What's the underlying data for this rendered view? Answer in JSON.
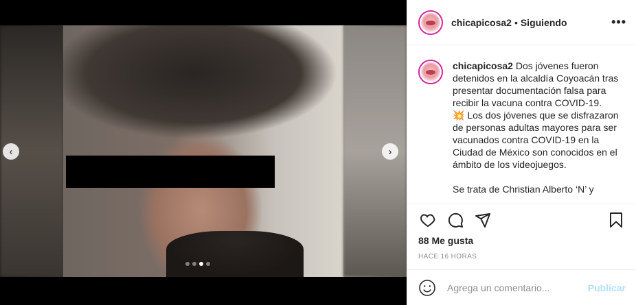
{
  "post": {
    "username": "chicapicosa2",
    "separator": "•",
    "follow_status": "Siguiendo",
    "more_label": "•••",
    "caption_lines": [
      "Dos jóvenes fueron",
      "detenidos en la alcaldía Coyoacán tras",
      "presentar documentación falsa para",
      "recibir la vacuna contra COVID-19.",
      "Los dos jóvenes que se disfrazaron",
      "de personas adultas mayores para ser",
      "vacunados contra COVID-19 en la",
      "Ciudad de México son conocidos en el",
      "ámbito de los videojuegos.",
      "Se trata de Christian Alberto ‘N’ y"
    ],
    "boom_emoji": "💥",
    "likes": "88 Me gusta",
    "timestamp": "HACE 16 HORAS",
    "comment_placeholder": "Agrega un comentario...",
    "publish_label": "Publicar"
  },
  "carousel": {
    "prev_glyph": "‹",
    "next_glyph": "›",
    "slide_count": 4,
    "active_slide": 3
  },
  "icons": {
    "like": "heart-icon",
    "comment": "comment-icon",
    "share": "share-icon",
    "save": "bookmark-icon",
    "emoji": "smiley-icon"
  }
}
